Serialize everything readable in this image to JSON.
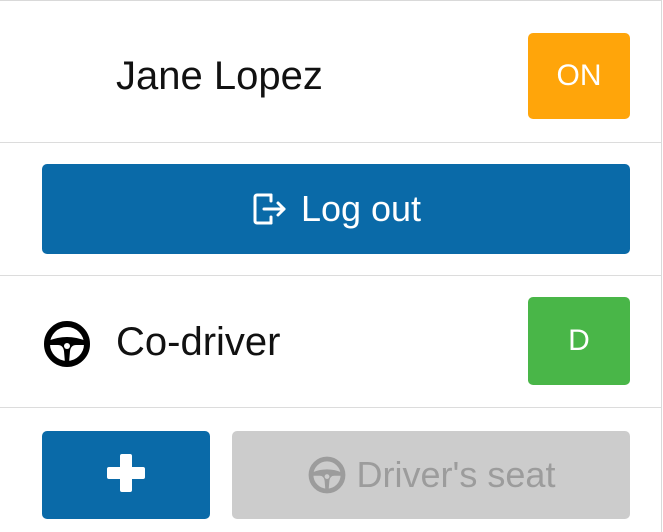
{
  "user": {
    "name": "Jane Lopez",
    "status_badge": "ON"
  },
  "actions": {
    "logout_label": "Log out",
    "logout_icon": "sign-out-icon"
  },
  "codriver": {
    "label": "Co-driver",
    "icon": "steering-wheel-icon",
    "role_badge": "D"
  },
  "footer": {
    "add_icon": "plus-icon",
    "seat_label": "Driver's seat",
    "seat_icon": "steering-wheel-icon",
    "seat_disabled": true
  },
  "colors": {
    "primary": "#0a6aa8",
    "status_on": "#ffa50a",
    "role_d": "#49b648",
    "disabled_bg": "#cccccc",
    "disabled_text": "#9c9c9c"
  }
}
